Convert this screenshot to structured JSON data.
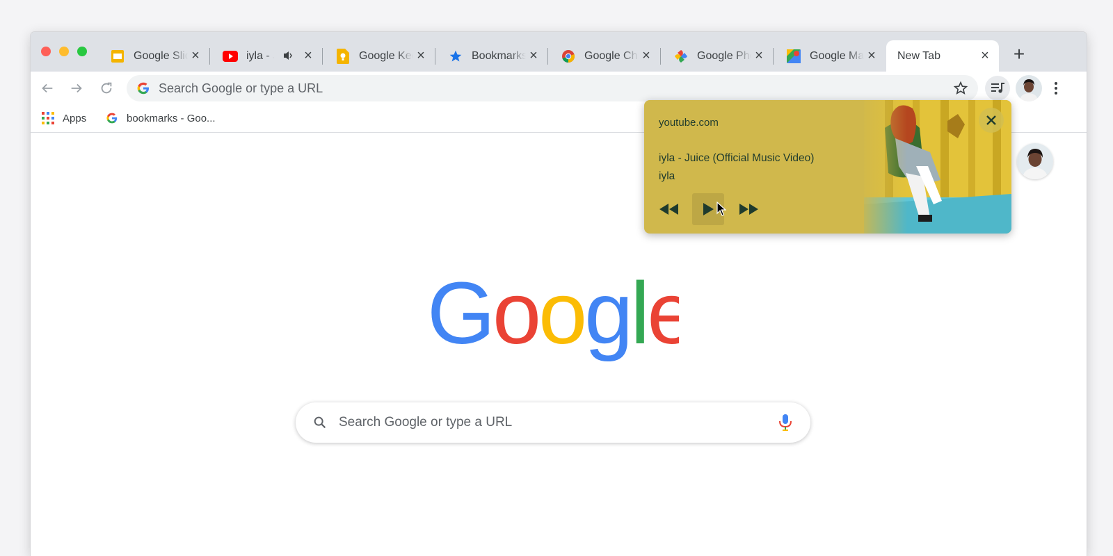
{
  "tabs": [
    {
      "title": "Google Slides",
      "icon": "slides-icon"
    },
    {
      "title": "iyla - Juice (Official Music Video)",
      "icon": "youtube-icon",
      "audio": true
    },
    {
      "title": "Google Keep",
      "icon": "keep-icon"
    },
    {
      "title": "Bookmarks",
      "icon": "bookmark-star-icon"
    },
    {
      "title": "Google Chrome",
      "icon": "chrome-icon"
    },
    {
      "title": "Google Photos",
      "icon": "photos-icon"
    },
    {
      "title": "Google Maps",
      "icon": "maps-icon"
    },
    {
      "title": "New Tab",
      "icon": "",
      "active": true
    }
  ],
  "omnibox": {
    "placeholder": "Search Google or type a URL"
  },
  "bookmarks": [
    {
      "label": "Apps",
      "icon": "apps-grid-icon"
    },
    {
      "label": "bookmarks - Goo...",
      "icon": "google-g-icon"
    }
  ],
  "search": {
    "placeholder": "Search Google or type a URL"
  },
  "logo": {
    "letters": [
      "G",
      "o",
      "o",
      "g",
      "l",
      "e"
    ]
  },
  "media_popup": {
    "source": "youtube.com",
    "track": "iyla - Juice (Official Music Video)",
    "artist": "iyla"
  },
  "colors": {
    "tabstrip": "#dee1e6",
    "media_bg": "#d0b84c",
    "google_blue": "#4285f4",
    "google_red": "#ea4335",
    "google_yellow": "#fbbc05",
    "google_green": "#34a853"
  }
}
